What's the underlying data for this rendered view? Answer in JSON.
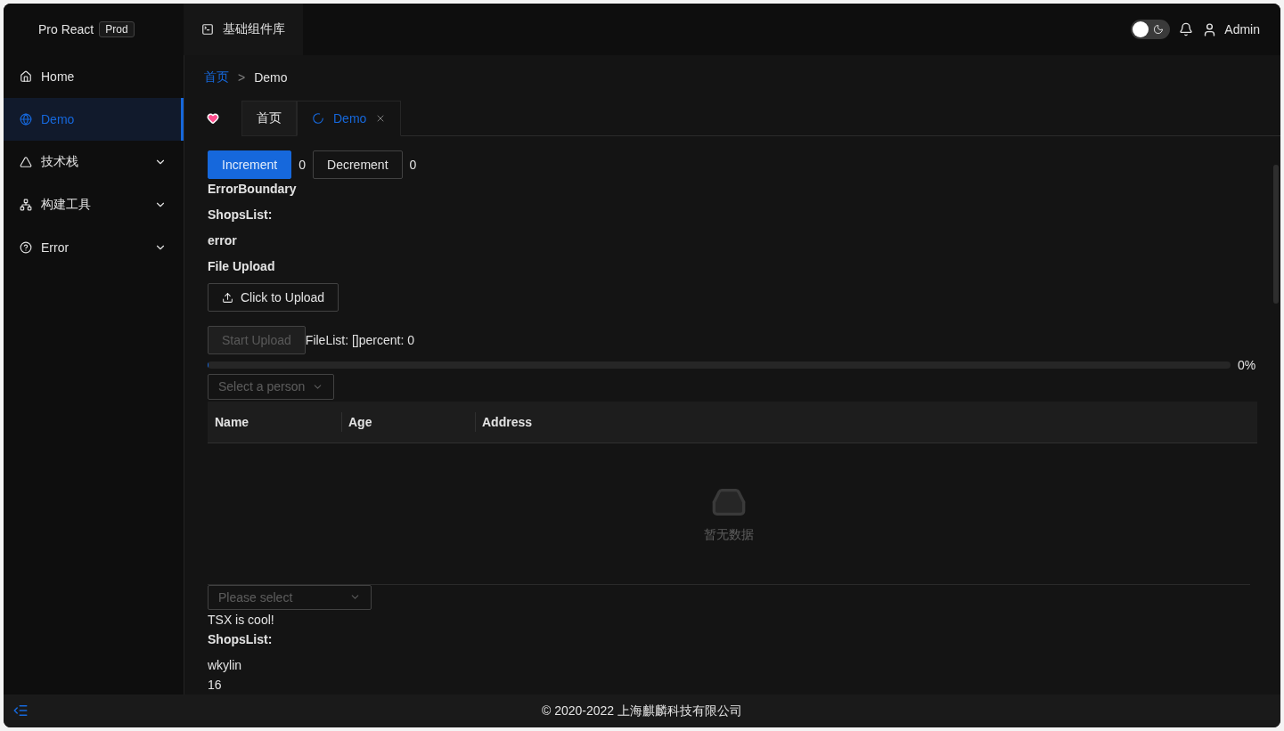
{
  "header": {
    "brand": "Pro React",
    "env_badge": "Prod",
    "top_tab": "基础组件库",
    "theme_switch": {
      "checked": false
    },
    "user": "Admin"
  },
  "sidebar": {
    "items": [
      {
        "label": "Home",
        "selected": false,
        "expandable": false
      },
      {
        "label": "Demo",
        "selected": true,
        "expandable": false
      },
      {
        "label": "技术栈",
        "selected": false,
        "expandable": true
      },
      {
        "label": "构建工具",
        "selected": false,
        "expandable": true
      },
      {
        "label": "Error",
        "selected": false,
        "expandable": true
      }
    ]
  },
  "breadcrumb": {
    "items": [
      "首页",
      "Demo"
    ],
    "separator": ">"
  },
  "tabs": [
    {
      "kind": "icon",
      "selected": false
    },
    {
      "kind": "text",
      "label": "首页",
      "selected": false,
      "closable": false,
      "loading": false
    },
    {
      "kind": "text",
      "label": "Demo",
      "selected": true,
      "closable": true,
      "loading": true
    }
  ],
  "counter": {
    "increment": "Increment",
    "increment_value": "0",
    "decrement": "Decrement",
    "decrement_value": "0"
  },
  "texts": [
    {
      "text": "ErrorBoundary",
      "kind": "heading"
    },
    {
      "text": "ShopsList:",
      "kind": "heading"
    },
    {
      "text": "error",
      "kind": "heading"
    },
    {
      "text": "File Upload",
      "kind": "heading"
    }
  ],
  "upload": {
    "button": "Click to Upload",
    "start": "Start Upload",
    "start_disabled": true,
    "status": "FileList: []percent: 0",
    "level": 0,
    "percent": "0%"
  },
  "person_select": {
    "placeholder": "Select a person"
  },
  "table": {
    "columns": [
      "Name",
      "Age",
      "Address"
    ],
    "empty": "暂无数据"
  },
  "please_select": {
    "placeholder": "Please select"
  },
  "lines": [
    {
      "text": "TSX is cool!",
      "kind": "plain"
    },
    {
      "text": "ShopsList:",
      "kind": "heading"
    },
    {
      "text": "wkylin",
      "kind": "plain"
    },
    {
      "text": "16",
      "kind": "plain"
    }
  ],
  "footer": "© 2020-2022 上海麒麟科技有限公司"
}
